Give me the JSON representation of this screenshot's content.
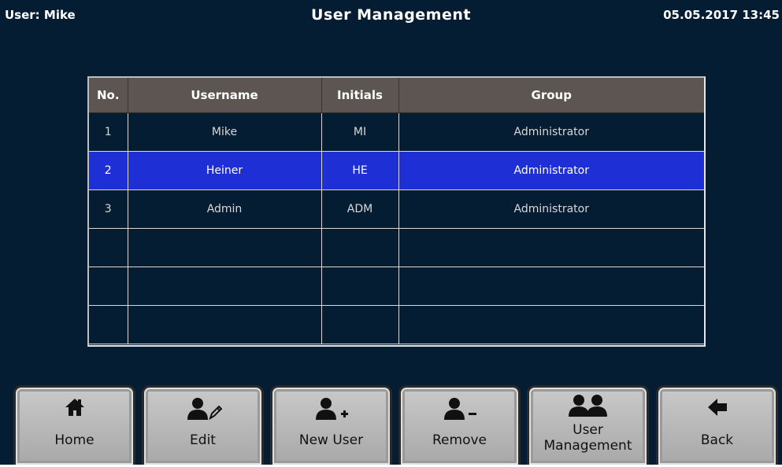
{
  "header": {
    "user": "User: Mike",
    "title": "User Management",
    "datetime": "05.05.2017 13:45"
  },
  "table": {
    "columns": [
      "No.",
      "Username",
      "Initials",
      "Group"
    ],
    "rows": [
      {
        "no": "1",
        "username": "Mike",
        "initials": "MI",
        "group": "Administrator",
        "selected": false
      },
      {
        "no": "2",
        "username": "Heiner",
        "initials": "HE",
        "group": "Administrator",
        "selected": true
      },
      {
        "no": "3",
        "username": "Admin",
        "initials": "ADM",
        "group": "Administrator",
        "selected": false
      },
      {
        "no": "",
        "username": "",
        "initials": "",
        "group": "",
        "selected": false
      },
      {
        "no": "",
        "username": "",
        "initials": "",
        "group": "",
        "selected": false
      },
      {
        "no": "",
        "username": "",
        "initials": "",
        "group": "",
        "selected": false
      }
    ]
  },
  "buttons": [
    {
      "label": "Home",
      "icon": "home-icon"
    },
    {
      "label": "Edit",
      "icon": "user-edit-icon"
    },
    {
      "label": "New User",
      "icon": "user-add-icon"
    },
    {
      "label": "Remove",
      "icon": "user-remove-icon"
    },
    {
      "label": "User Management",
      "icon": "users-icon"
    },
    {
      "label": "Back",
      "icon": "arrow-left-icon"
    }
  ],
  "colors": {
    "background": "#051d33",
    "header_row": "#5c5552",
    "selected_row": "#1f2fd6",
    "button_face": "#b8b8b8"
  }
}
